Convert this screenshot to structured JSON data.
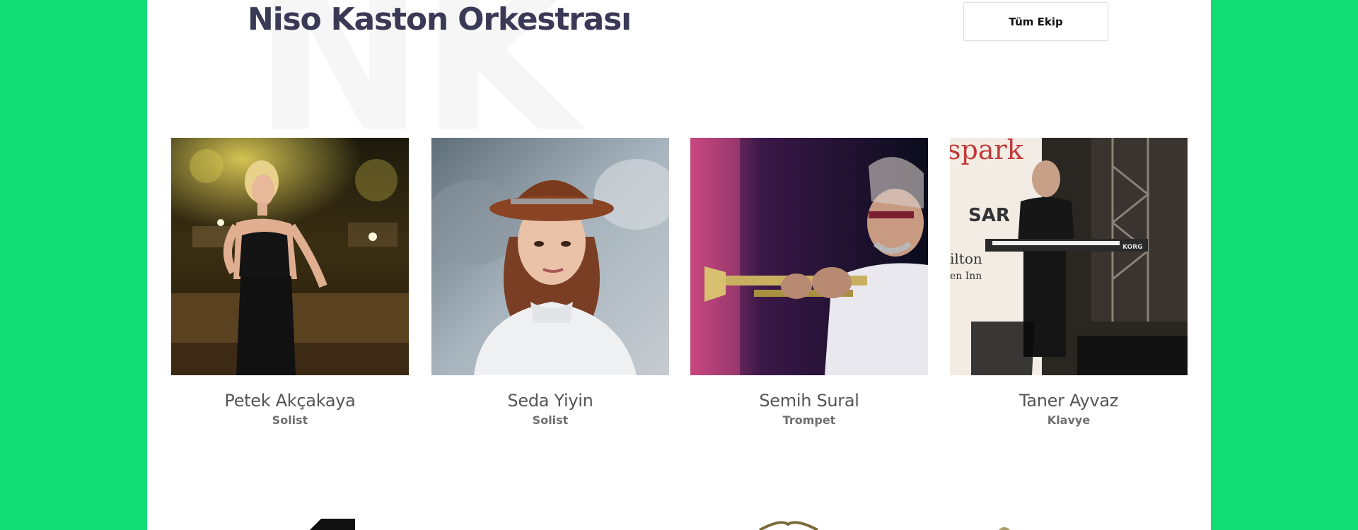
{
  "section": {
    "watermark": "NK",
    "title": "Niso Kaston Orkestrası",
    "team_button": "Tüm Ekip"
  },
  "members": [
    {
      "name": "Petek Akçakaya",
      "role": "Solist"
    },
    {
      "name": "Seda Yiyin",
      "role": "Solist"
    },
    {
      "name": "Semih Sural",
      "role": "Trompet"
    },
    {
      "name": "Taner Ayvaz",
      "role": "Klavye"
    }
  ],
  "photo_text": {
    "banner_brand": "spark",
    "banner_word": "SAR",
    "banner_hotel": "ilton",
    "banner_hotel_sub": "en Inn",
    "keyboard_brand": "KORG"
  },
  "colors": {
    "page_bg": "#11dd74",
    "content_bg": "#ffffff",
    "heading": "#3a3a56",
    "name_text": "#555555",
    "role_text": "#6e6e6e"
  }
}
